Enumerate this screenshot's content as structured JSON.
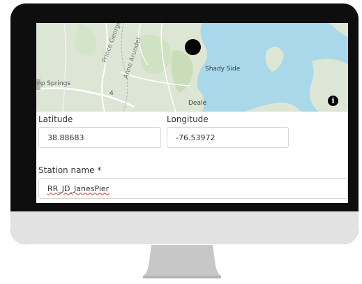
{
  "map": {
    "labels": {
      "springs": "np Springs",
      "shady_side": "Shady Side",
      "deale": "Deale",
      "prince_georges": "Prince George's",
      "anne_arundel": "Anne Arundel",
      "route": "4"
    },
    "marker_icon": "location-marker-dot",
    "info_icon": "info-icon",
    "info_glyph": "i",
    "colors": {
      "land": "#dde6d4",
      "water": "#a8d8ea",
      "marker": "#000000"
    }
  },
  "form": {
    "latitude": {
      "label": "Latitude",
      "value": "38.88683"
    },
    "longitude": {
      "label": "Longitude",
      "value": "-76.53972"
    },
    "station_name": {
      "label": "Station name *",
      "value": "RR_JD_JanesPier"
    }
  },
  "colors": {
    "bezel": "#0e0e0e",
    "chin": "#e2e2e2",
    "stand": "#c7c7c7"
  }
}
